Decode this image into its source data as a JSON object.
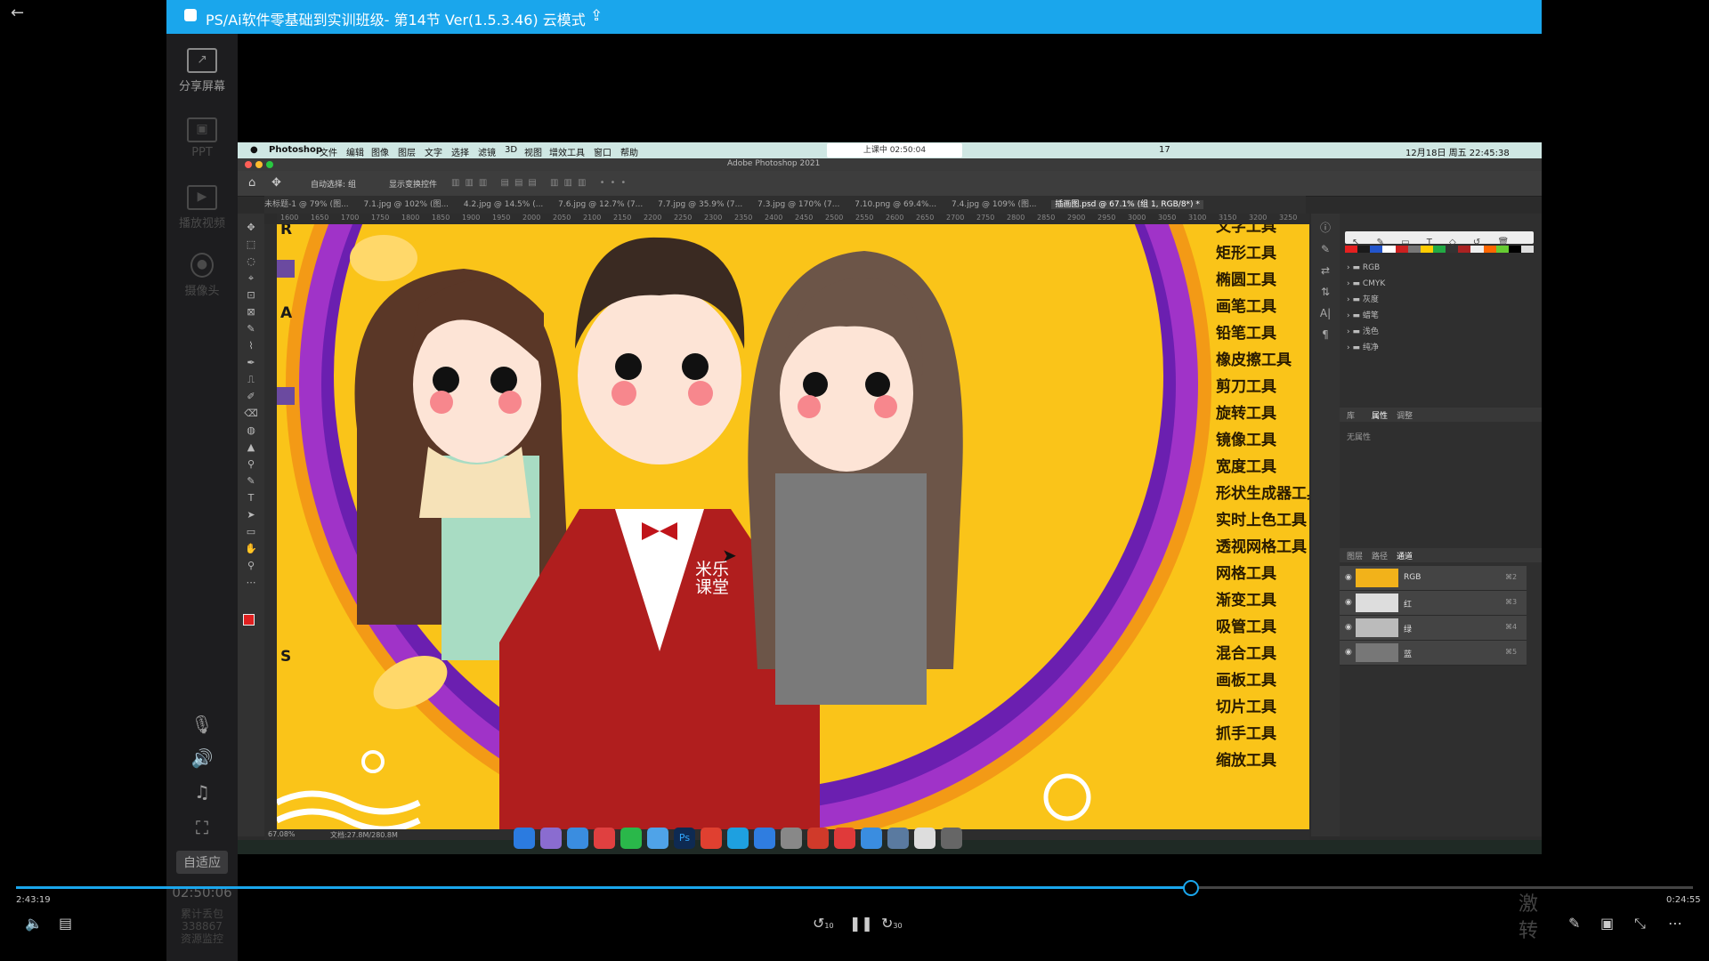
{
  "window": {
    "title": "PS/Ai软件零基础到实训班级- 第14节 Ver(1.5.3.46)  云模式",
    "back_glyph": "←",
    "share_glyph": "⇪"
  },
  "left_panel": {
    "share_screen": "分享屏幕",
    "ppt": "PPT",
    "play_video": "播放视频",
    "camera": "摄像头",
    "adapt": "自适应",
    "clock": "02:50:06",
    "stats": [
      "累计丢包",
      "338867",
      "资源监控"
    ]
  },
  "mac_menu": {
    "items": [
      "Photoshop",
      "文件",
      "编辑",
      "图像",
      "图层",
      "文字",
      "选择",
      "滤镜",
      "3D",
      "视图",
      "增效工具",
      "窗口",
      "帮助"
    ],
    "live": "上课中 02:50:04",
    "right": "12月18日 周五 22:45:38",
    "badge": "17"
  },
  "photoshop": {
    "app_title": "Adobe Photoshop 2021",
    "options": [
      "自动选择:",
      "组",
      "显示变换控件"
    ],
    "tabs": [
      "未标题-1 @ 79% (图...",
      "7.1.jpg @ 102% (图...",
      "4.2.jpg @ 14.5% (...",
      "7.6.jpg @ 12.7% (7...",
      "7.7.jpg @ 35.9% (7...",
      "7.3.jpg @ 170% (7...",
      "7.10.png @ 69.4%...",
      "7.4.jpg @ 109% (图...",
      "插画图.psd @ 67.1% (组 1, RGB/8*) *"
    ],
    "ruler_marks": [
      "1600",
      "1650",
      "1700",
      "1750",
      "1800",
      "1850",
      "1900",
      "1950",
      "2000",
      "2050",
      "2100",
      "2150",
      "2200",
      "2250",
      "2300",
      "2350",
      "2400",
      "2450",
      "2500",
      "2550",
      "2600",
      "2650",
      "2700",
      "2750",
      "2800",
      "2850",
      "2900",
      "2950",
      "3000",
      "3050",
      "3100",
      "3150",
      "3200",
      "3250"
    ],
    "status_zoom": "67.08%",
    "status_doc": "文档:27.8M/280.8M",
    "canvas_letters": [
      "R",
      "A",
      "S"
    ],
    "watermark": [
      "米乐",
      "课堂"
    ],
    "tool_names": [
      "文字工具",
      "矩形工具",
      "椭圆工具",
      "画笔工具",
      "铅笔工具",
      "橡皮擦工具",
      "剪刀工具",
      "旋转工具",
      "镜像工具",
      "宽度工具",
      "形状生成器工具",
      "实时上色工具",
      "透视网格工具",
      "网格工具",
      "渐变工具",
      "吸管工具",
      "混合工具",
      "画板工具",
      "切片工具",
      "抓手工具",
      "缩放工具"
    ],
    "swatch_folders": [
      "RGB",
      "CMYK",
      "灰度",
      "蜡笔",
      "浅色",
      "纯净"
    ],
    "props_tabs": [
      "库",
      "属性",
      "调整"
    ],
    "props_empty": "无属性",
    "channel_tabs": [
      "图层",
      "路径",
      "通道"
    ],
    "channels": [
      {
        "name": "RGB",
        "shortcut": "⌘2"
      },
      {
        "name": "红",
        "shortcut": "⌘3"
      },
      {
        "name": "绿",
        "shortcut": "⌘4"
      },
      {
        "name": "蓝",
        "shortcut": "⌘5"
      }
    ],
    "swatch_colors": [
      "#e52020",
      "#1b1b1b",
      "#2255cc",
      "#ffffff",
      "#cc2020",
      "#777777",
      "#ffcc00",
      "#22aa44",
      "#333333",
      "#aa2222",
      "#eeeeee",
      "#ff6600",
      "#66cc33",
      "#000000",
      "#dddddd"
    ]
  },
  "player": {
    "elapsed": "2:43:19",
    "total": "0:24:55",
    "progress": 0.7,
    "rewind": "10",
    "forward": "30",
    "side_text": [
      "激",
      "转"
    ]
  }
}
